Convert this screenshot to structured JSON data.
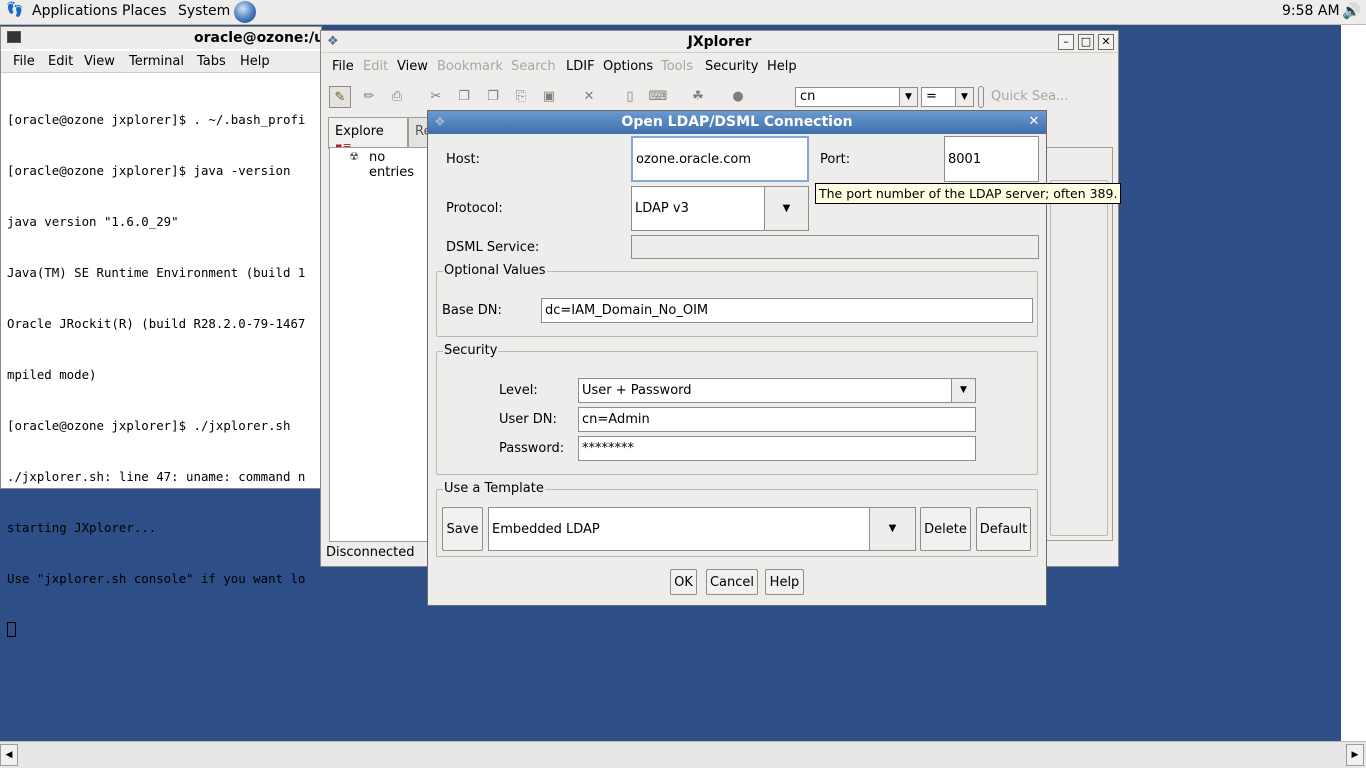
{
  "panel": {
    "applications": "Applications",
    "places": "Places",
    "system": "System",
    "clock": "9:58 AM"
  },
  "terminal": {
    "title": "oracle@ozone:/u",
    "menu": [
      "File",
      "Edit",
      "View",
      "Terminal",
      "Tabs",
      "Help"
    ],
    "lines": [
      "[oracle@ozone jxplorer]$ . ~/.bash_profi",
      "[oracle@ozone jxplorer]$ java -version",
      "java version \"1.6.0_29\"",
      "Java(TM) SE Runtime Environment (build 1",
      "Oracle JRockit(R) (build R28.2.0-79-1467",
      "mpiled mode)",
      "[oracle@ozone jxplorer]$ ./jxplorer.sh",
      "./jxplorer.sh: line 47: uname: command n",
      "starting JXplorer...",
      "Use \"jxplorer.sh console\" if you want lo"
    ]
  },
  "jxplorer": {
    "title": "JXplorer",
    "menu": [
      {
        "label": "File",
        "enabled": true
      },
      {
        "label": "Edit",
        "enabled": false
      },
      {
        "label": "View",
        "enabled": true
      },
      {
        "label": "Bookmark",
        "enabled": false
      },
      {
        "label": "Search",
        "enabled": false
      },
      {
        "label": "LDIF",
        "enabled": true
      },
      {
        "label": "Options",
        "enabled": true
      },
      {
        "label": "Tools",
        "enabled": false
      },
      {
        "label": "Security",
        "enabled": true
      },
      {
        "label": "Help",
        "enabled": true
      }
    ],
    "search_attr": "cn",
    "search_op": "=",
    "quick_search_placeholder": "Quick Sea...",
    "tab_explore": "Explore",
    "tab_results": "Re",
    "tree_empty": "no entries",
    "status": "Disconnected"
  },
  "dialog": {
    "title": "Open LDAP/DSML Connection",
    "host_label": "Host:",
    "host_value": "ozone.oracle.com",
    "port_label": "Port:",
    "port_value": "8001",
    "tooltip": "The port number of the LDAP server; often 389.",
    "protocol_label": "Protocol:",
    "protocol_value": "LDAP v3",
    "dsml_label": "DSML Service:",
    "dsml_value": "",
    "optional_group": "Optional Values",
    "basedn_label": "Base DN:",
    "basedn_value": "dc=IAM_Domain_No_OIM",
    "security_group": "Security",
    "level_label": "Level:",
    "level_value": "User + Password",
    "userdn_label": "User DN:",
    "userdn_value": "cn=Admin",
    "password_label": "Password:",
    "password_value": "********",
    "template_group": "Use a Template",
    "save": "Save",
    "template_value": "Embedded LDAP",
    "delete": "Delete",
    "default": "Default",
    "ok": "OK",
    "cancel": "Cancel",
    "help": "Help"
  }
}
